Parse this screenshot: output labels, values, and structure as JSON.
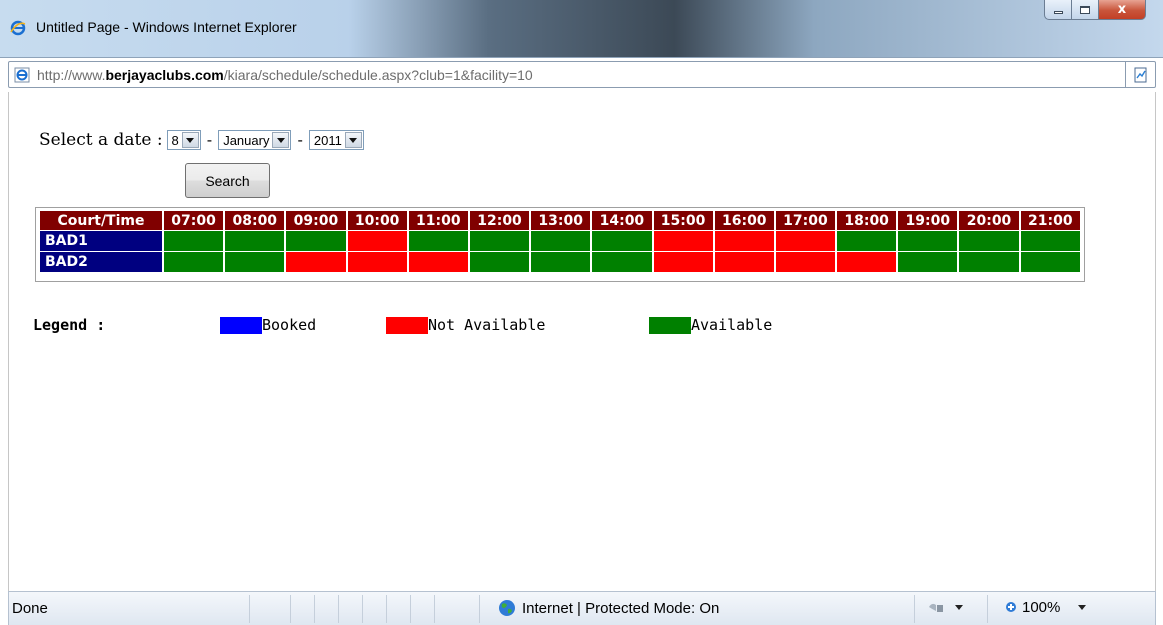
{
  "window": {
    "title": "Untitled Page - Windows Internet Explorer",
    "controls": {
      "minimize": "minimize",
      "maximize": "maximize",
      "close": "x"
    }
  },
  "address": {
    "prefix": "http://www.",
    "domain": "berjayaclubs.com",
    "path": "/kiara/schedule/schedule.aspx?club=1&facility=10"
  },
  "date_select": {
    "label": "Select a date :",
    "day": "8",
    "month": "January",
    "year": "2011",
    "separator": "-"
  },
  "search_label": "Search",
  "schedule": {
    "header_first": "Court/Time",
    "times": [
      "07:00",
      "08:00",
      "09:00",
      "10:00",
      "11:00",
      "12:00",
      "13:00",
      "14:00",
      "15:00",
      "16:00",
      "17:00",
      "18:00",
      "19:00",
      "20:00",
      "21:00"
    ],
    "rows": [
      {
        "court": "BAD1",
        "slots": [
          "av",
          "av",
          "av",
          "na",
          "av",
          "av",
          "av",
          "av",
          "na",
          "na",
          "na",
          "av",
          "av",
          "av",
          "av"
        ]
      },
      {
        "court": "BAD2",
        "slots": [
          "av",
          "av",
          "na",
          "na",
          "na",
          "av",
          "av",
          "av",
          "na",
          "na",
          "na",
          "na",
          "av",
          "av",
          "av"
        ]
      }
    ]
  },
  "legend": {
    "title": "Legend :",
    "items": [
      {
        "label": "Booked",
        "color": "#0000ff"
      },
      {
        "label": "Not Available",
        "color": "#ff0000"
      },
      {
        "label": "Available",
        "color": "#008000"
      }
    ]
  },
  "status": {
    "text": "Done",
    "zone": "Internet | Protected Mode: On",
    "zoom": "100%"
  }
}
